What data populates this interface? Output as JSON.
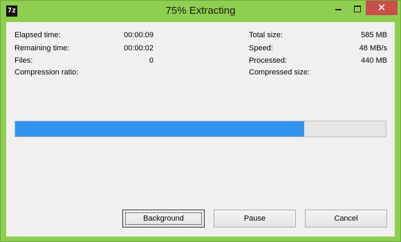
{
  "window": {
    "title": "75% Extracting",
    "app_icon_text": "7z",
    "close_glyph": "✕"
  },
  "stats_left": [
    {
      "label": "Elapsed time:",
      "value": "00:00:09"
    },
    {
      "label": "Remaining time:",
      "value": "00:00:02"
    },
    {
      "label": "Files:",
      "value": "0"
    },
    {
      "label": "Compression ratio:",
      "value": ""
    }
  ],
  "stats_right": [
    {
      "label": "Total size:",
      "value": "585 MB"
    },
    {
      "label": "Speed:",
      "value": "48 MB/s"
    },
    {
      "label": "Processed:",
      "value": "440 MB"
    },
    {
      "label": "Compressed size:",
      "value": ""
    }
  ],
  "progress": {
    "fraction": 0.78
  },
  "buttons": {
    "background": "Background",
    "pause": "Pause",
    "cancel": "Cancel"
  },
  "colors": {
    "window_frame": "#8fcf4f",
    "progress_fill": "#2f95ef",
    "close_button": "#c7504a"
  }
}
